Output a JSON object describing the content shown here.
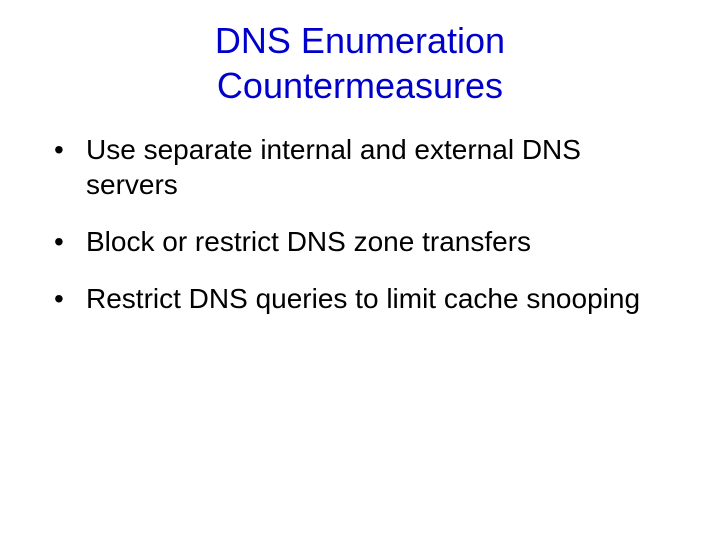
{
  "title_line1": "DNS Enumeration",
  "title_line2": "Countermeasures",
  "bullets": [
    "Use separate internal and external DNS servers",
    "Block or restrict DNS zone transfers",
    "Restrict DNS queries to limit cache snooping"
  ]
}
